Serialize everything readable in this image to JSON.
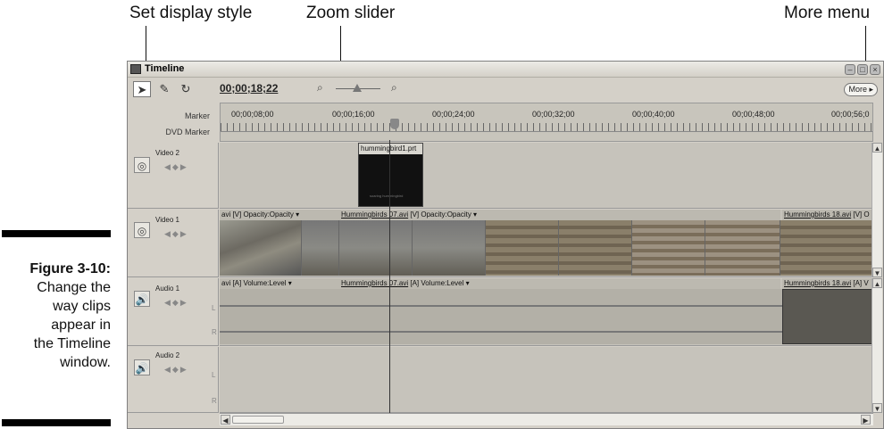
{
  "callouts": {
    "set_display_style": "Set display style",
    "zoom_slider": "Zoom slider",
    "more_menu": "More menu"
  },
  "caption": {
    "figure": "Figure 3-10:",
    "line1": "Change the",
    "line2": "way clips",
    "line3": "appear in",
    "line4": "the Timeline",
    "line5": "window."
  },
  "window": {
    "title": "Timeline",
    "timecode": "00;00;18;22",
    "more_label": "More ▸",
    "tools": [
      "selection-tool-icon",
      "razor-tool-icon",
      "ripple-tool-icon"
    ],
    "ruler": {
      "marker_label": "Marker",
      "dvd_marker_label": "DVD Marker",
      "ticks": [
        "00;00;08;00",
        "00;00;16;00",
        "00;00;24;00",
        "00;00;32;00",
        "00;00;40;00",
        "00;00;48;00",
        "00;00;56;0"
      ]
    },
    "tracks": {
      "video2": {
        "name": "Video 2",
        "clip": "hummingbird1.prt",
        "clip_caption": "soaring hummingbird"
      },
      "video1": {
        "name": "Video 1",
        "clip1": "avi [V] Opacity:Opacity ▾",
        "clip2_name": "Hummingbirds 07.avi",
        "clip2_rest": " [V] Opacity:Opacity ▾",
        "clip3_name": "Hummingbirds 18.avi",
        "clip3_rest": " [V] O"
      },
      "audio1": {
        "name": "Audio 1",
        "clip1": "avi [A] Volume:Level ▾",
        "clip2_name": "Hummingbirds 07.avi",
        "clip2_rest": " [A] Volume:Level ▾",
        "clip3_name": "Hummingbirds 18.avi",
        "clip3_rest": " [A] V"
      },
      "audio2": {
        "name": "Audio 2"
      },
      "left_label": "L",
      "right_label": "R"
    }
  }
}
